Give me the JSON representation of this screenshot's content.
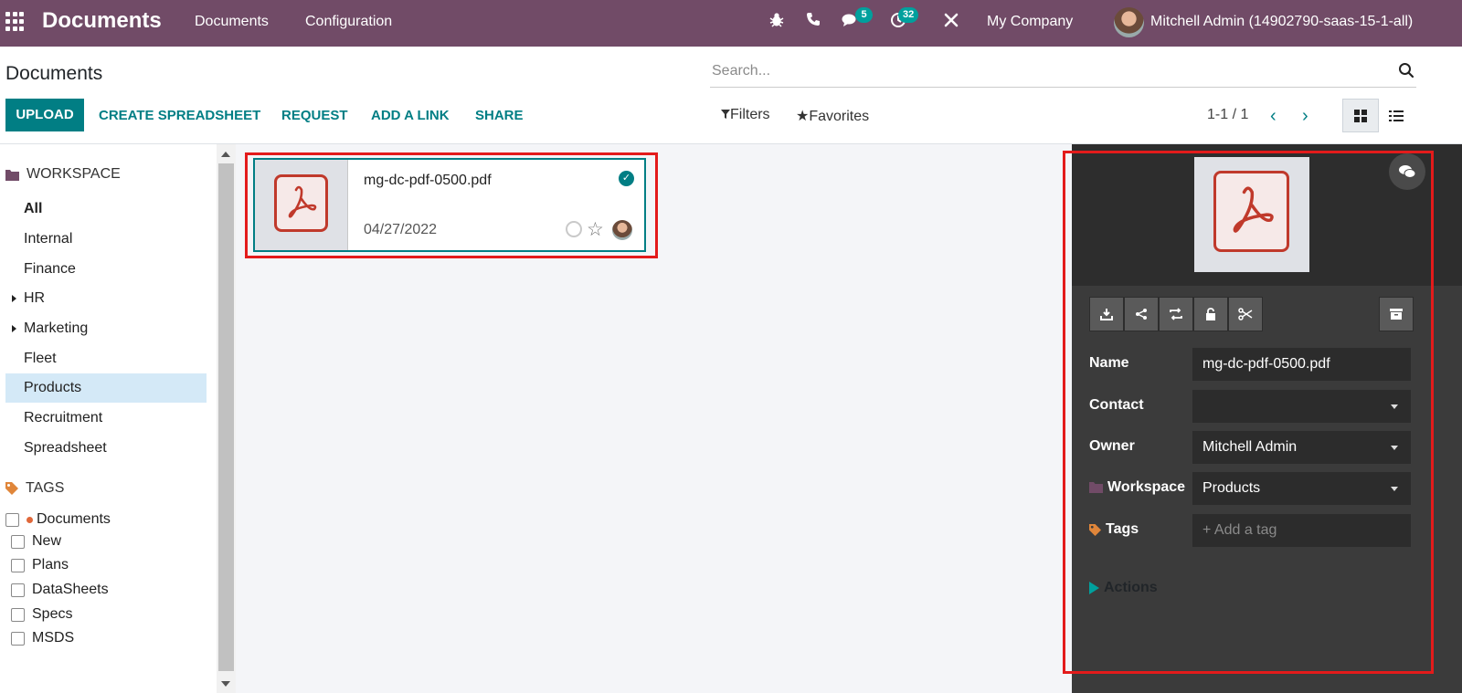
{
  "navbar": {
    "app_title": "Documents",
    "menus": [
      "Documents",
      "Configuration"
    ],
    "messages_badge": "5",
    "activities_badge": "32",
    "company": "My Company",
    "user": "Mitchell Admin (14902790-saas-15-1-all)",
    "bg_color": "#714B67"
  },
  "control_panel": {
    "title": "Documents",
    "search_placeholder": "Search...",
    "buttons": {
      "upload": "UPLOAD",
      "create_spreadsheet": "CREATE SPREADSHEET",
      "request": "REQUEST",
      "add_link": "ADD A LINK",
      "share": "SHARE"
    },
    "filters": "Filters",
    "favorites": "Favorites",
    "pager": "1-1 / 1",
    "accent_color": "#017E84"
  },
  "sidebar": {
    "workspace_header": "WORKSPACE",
    "workspaces": [
      {
        "label": "All"
      },
      {
        "label": "Internal"
      },
      {
        "label": "Finance"
      },
      {
        "label": "HR"
      },
      {
        "label": "Marketing"
      },
      {
        "label": "Fleet"
      },
      {
        "label": "Products"
      },
      {
        "label": "Recruitment"
      },
      {
        "label": "Spreadsheet"
      }
    ],
    "selected_workspace": "Products",
    "tags_header": "TAGS",
    "tag_category": "Documents",
    "tags": [
      "New",
      "Plans",
      "DataSheets",
      "Specs",
      "MSDS"
    ]
  },
  "document": {
    "name": "mg-dc-pdf-0500.pdf",
    "date": "04/27/2022",
    "icon": "pdf-icon"
  },
  "inspector": {
    "fields": {
      "name_label": "Name",
      "name_value": "mg-dc-pdf-0500.pdf",
      "contact_label": "Contact",
      "contact_value": "",
      "owner_label": "Owner",
      "owner_value": "Mitchell Admin",
      "workspace_label": "Workspace",
      "workspace_value": "Products",
      "tags_label": "Tags",
      "tags_placeholder": "+ Add a tag"
    },
    "actions_label": "Actions",
    "toolbar_icons": [
      "download-icon",
      "share-icon",
      "replace-icon",
      "lock-icon",
      "split-icon",
      "archive-icon"
    ]
  }
}
